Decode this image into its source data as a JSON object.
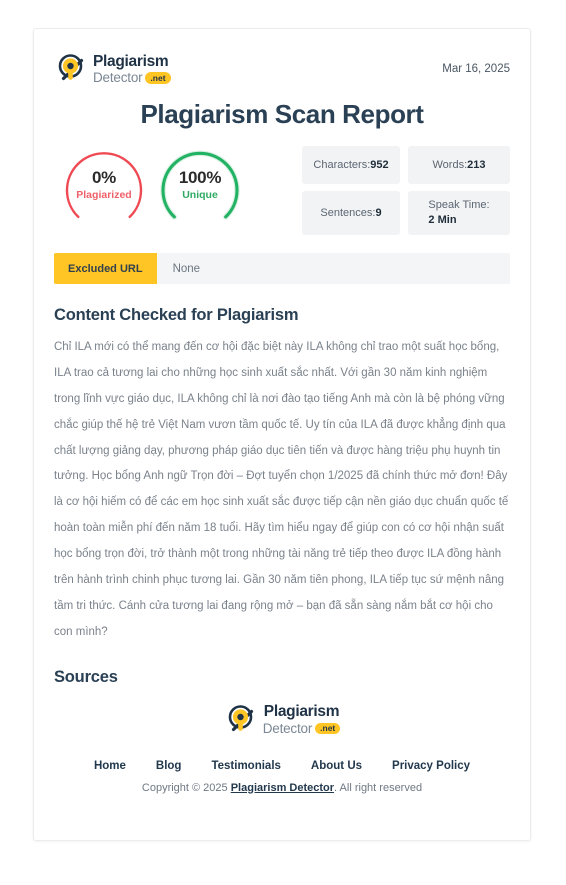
{
  "brand": {
    "name_top": "Plagiarism",
    "name_bottom": "Detector",
    "tld_badge": ".net",
    "logo_icon": "magnifier-logo-icon",
    "accent_yellow": "#ffc524",
    "accent_navy": "#1f3246"
  },
  "header": {
    "date": "Mar 16, 2025"
  },
  "title": "Plagiarism Scan Report",
  "scores": {
    "plagiarized": {
      "percent_label": "0%",
      "caption": "Plagiarized",
      "value": 0,
      "color": "#ef4a54",
      "track_color": "#ffffff"
    },
    "unique": {
      "percent_label": "100%",
      "caption": "Unique",
      "value": 100,
      "color": "#22b263",
      "track_color": "#d7f0e0"
    }
  },
  "stats": [
    {
      "label": "Characters:",
      "value": "952"
    },
    {
      "label": "Words:",
      "value": "213"
    },
    {
      "label": "Sentences:",
      "value": "9"
    },
    {
      "label": "Speak Time:",
      "value": "2 Min"
    }
  ],
  "excluded_url": {
    "label": "Excluded URL",
    "value": "None"
  },
  "content": {
    "heading": "Content Checked for Plagiarism",
    "text": "Chỉ ILA mới có thể mang đến cơ hội đặc biệt này ILA không chỉ trao một suất học bổng, ILA trao cả tương lai cho những học sinh xuất sắc nhất. Với gần 30 năm kinh nghiệm trong lĩnh vực giáo dục, ILA không chỉ là nơi đào tạo tiếng Anh mà còn là bệ phóng vững chắc giúp thế hệ trẻ Việt Nam vươn tầm quốc tế. Uy tín của ILA đã được khẳng định qua chất lượng giảng dạy, phương pháp giáo dục tiên tiến và được hàng triệu phụ huynh tin tưởng. Học bổng Anh ngữ Trọn đời – Đợt tuyển chọn 1/2025 đã chính thức mở đơn! Đây là cơ hội hiếm có để các em học sinh xuất sắc được tiếp cận nền giáo dục chuẩn quốc tế hoàn toàn miễn phí đến năm 18 tuổi. Hãy tìm hiểu ngay để giúp con có cơ hội nhận suất học bổng trọn đời, trở thành một trong những tài năng trẻ tiếp theo được ILA đồng hành trên hành trình chinh phục tương lai. Gần 30 năm tiên phong, ILA tiếp tục sứ mệnh nâng tầm tri thức. Cánh cửa tương lai đang rộng mở – bạn đã sẵn sàng nắm bắt cơ hội cho con mình?"
  },
  "sources": {
    "heading": "Sources"
  },
  "footer": {
    "nav": [
      {
        "label": "Home"
      },
      {
        "label": "Blog"
      },
      {
        "label": "Testimonials"
      },
      {
        "label": "About Us"
      },
      {
        "label": "Privacy Policy"
      }
    ],
    "copyright_prefix": "Copyright © 2025 ",
    "copyright_link": "Plagiarism Detector",
    "copyright_suffix": ". All right reserved"
  }
}
